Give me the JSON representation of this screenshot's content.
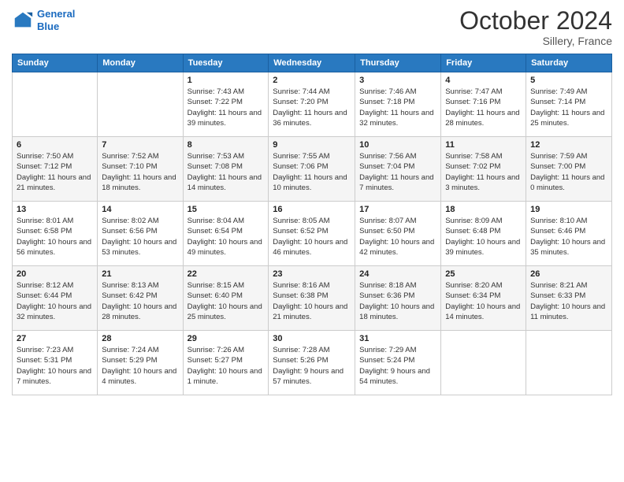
{
  "logo": {
    "line1": "General",
    "line2": "Blue"
  },
  "title": "October 2024",
  "location": "Sillery, France",
  "days": [
    "Sunday",
    "Monday",
    "Tuesday",
    "Wednesday",
    "Thursday",
    "Friday",
    "Saturday"
  ],
  "weeks": [
    [
      {
        "num": "",
        "sunrise": "",
        "sunset": "",
        "daylight": ""
      },
      {
        "num": "",
        "sunrise": "",
        "sunset": "",
        "daylight": ""
      },
      {
        "num": "1",
        "sunrise": "Sunrise: 7:43 AM",
        "sunset": "Sunset: 7:22 PM",
        "daylight": "Daylight: 11 hours and 39 minutes."
      },
      {
        "num": "2",
        "sunrise": "Sunrise: 7:44 AM",
        "sunset": "Sunset: 7:20 PM",
        "daylight": "Daylight: 11 hours and 36 minutes."
      },
      {
        "num": "3",
        "sunrise": "Sunrise: 7:46 AM",
        "sunset": "Sunset: 7:18 PM",
        "daylight": "Daylight: 11 hours and 32 minutes."
      },
      {
        "num": "4",
        "sunrise": "Sunrise: 7:47 AM",
        "sunset": "Sunset: 7:16 PM",
        "daylight": "Daylight: 11 hours and 28 minutes."
      },
      {
        "num": "5",
        "sunrise": "Sunrise: 7:49 AM",
        "sunset": "Sunset: 7:14 PM",
        "daylight": "Daylight: 11 hours and 25 minutes."
      }
    ],
    [
      {
        "num": "6",
        "sunrise": "Sunrise: 7:50 AM",
        "sunset": "Sunset: 7:12 PM",
        "daylight": "Daylight: 11 hours and 21 minutes."
      },
      {
        "num": "7",
        "sunrise": "Sunrise: 7:52 AM",
        "sunset": "Sunset: 7:10 PM",
        "daylight": "Daylight: 11 hours and 18 minutes."
      },
      {
        "num": "8",
        "sunrise": "Sunrise: 7:53 AM",
        "sunset": "Sunset: 7:08 PM",
        "daylight": "Daylight: 11 hours and 14 minutes."
      },
      {
        "num": "9",
        "sunrise": "Sunrise: 7:55 AM",
        "sunset": "Sunset: 7:06 PM",
        "daylight": "Daylight: 11 hours and 10 minutes."
      },
      {
        "num": "10",
        "sunrise": "Sunrise: 7:56 AM",
        "sunset": "Sunset: 7:04 PM",
        "daylight": "Daylight: 11 hours and 7 minutes."
      },
      {
        "num": "11",
        "sunrise": "Sunrise: 7:58 AM",
        "sunset": "Sunset: 7:02 PM",
        "daylight": "Daylight: 11 hours and 3 minutes."
      },
      {
        "num": "12",
        "sunrise": "Sunrise: 7:59 AM",
        "sunset": "Sunset: 7:00 PM",
        "daylight": "Daylight: 11 hours and 0 minutes."
      }
    ],
    [
      {
        "num": "13",
        "sunrise": "Sunrise: 8:01 AM",
        "sunset": "Sunset: 6:58 PM",
        "daylight": "Daylight: 10 hours and 56 minutes."
      },
      {
        "num": "14",
        "sunrise": "Sunrise: 8:02 AM",
        "sunset": "Sunset: 6:56 PM",
        "daylight": "Daylight: 10 hours and 53 minutes."
      },
      {
        "num": "15",
        "sunrise": "Sunrise: 8:04 AM",
        "sunset": "Sunset: 6:54 PM",
        "daylight": "Daylight: 10 hours and 49 minutes."
      },
      {
        "num": "16",
        "sunrise": "Sunrise: 8:05 AM",
        "sunset": "Sunset: 6:52 PM",
        "daylight": "Daylight: 10 hours and 46 minutes."
      },
      {
        "num": "17",
        "sunrise": "Sunrise: 8:07 AM",
        "sunset": "Sunset: 6:50 PM",
        "daylight": "Daylight: 10 hours and 42 minutes."
      },
      {
        "num": "18",
        "sunrise": "Sunrise: 8:09 AM",
        "sunset": "Sunset: 6:48 PM",
        "daylight": "Daylight: 10 hours and 39 minutes."
      },
      {
        "num": "19",
        "sunrise": "Sunrise: 8:10 AM",
        "sunset": "Sunset: 6:46 PM",
        "daylight": "Daylight: 10 hours and 35 minutes."
      }
    ],
    [
      {
        "num": "20",
        "sunrise": "Sunrise: 8:12 AM",
        "sunset": "Sunset: 6:44 PM",
        "daylight": "Daylight: 10 hours and 32 minutes."
      },
      {
        "num": "21",
        "sunrise": "Sunrise: 8:13 AM",
        "sunset": "Sunset: 6:42 PM",
        "daylight": "Daylight: 10 hours and 28 minutes."
      },
      {
        "num": "22",
        "sunrise": "Sunrise: 8:15 AM",
        "sunset": "Sunset: 6:40 PM",
        "daylight": "Daylight: 10 hours and 25 minutes."
      },
      {
        "num": "23",
        "sunrise": "Sunrise: 8:16 AM",
        "sunset": "Sunset: 6:38 PM",
        "daylight": "Daylight: 10 hours and 21 minutes."
      },
      {
        "num": "24",
        "sunrise": "Sunrise: 8:18 AM",
        "sunset": "Sunset: 6:36 PM",
        "daylight": "Daylight: 10 hours and 18 minutes."
      },
      {
        "num": "25",
        "sunrise": "Sunrise: 8:20 AM",
        "sunset": "Sunset: 6:34 PM",
        "daylight": "Daylight: 10 hours and 14 minutes."
      },
      {
        "num": "26",
        "sunrise": "Sunrise: 8:21 AM",
        "sunset": "Sunset: 6:33 PM",
        "daylight": "Daylight: 10 hours and 11 minutes."
      }
    ],
    [
      {
        "num": "27",
        "sunrise": "Sunrise: 7:23 AM",
        "sunset": "Sunset: 5:31 PM",
        "daylight": "Daylight: 10 hours and 7 minutes."
      },
      {
        "num": "28",
        "sunrise": "Sunrise: 7:24 AM",
        "sunset": "Sunset: 5:29 PM",
        "daylight": "Daylight: 10 hours and 4 minutes."
      },
      {
        "num": "29",
        "sunrise": "Sunrise: 7:26 AM",
        "sunset": "Sunset: 5:27 PM",
        "daylight": "Daylight: 10 hours and 1 minute."
      },
      {
        "num": "30",
        "sunrise": "Sunrise: 7:28 AM",
        "sunset": "Sunset: 5:26 PM",
        "daylight": "Daylight: 9 hours and 57 minutes."
      },
      {
        "num": "31",
        "sunrise": "Sunrise: 7:29 AM",
        "sunset": "Sunset: 5:24 PM",
        "daylight": "Daylight: 9 hours and 54 minutes."
      },
      {
        "num": "",
        "sunrise": "",
        "sunset": "",
        "daylight": ""
      },
      {
        "num": "",
        "sunrise": "",
        "sunset": "",
        "daylight": ""
      }
    ]
  ]
}
